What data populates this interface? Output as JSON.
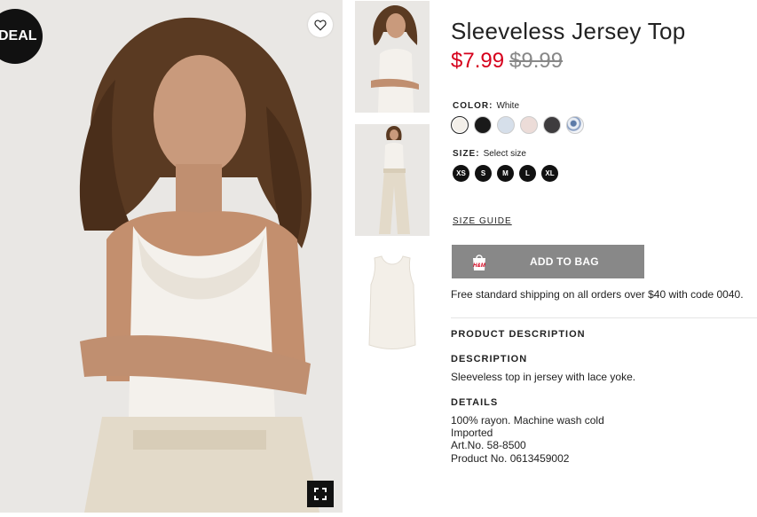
{
  "badge": {
    "deal": "DEAL"
  },
  "product": {
    "title": "Sleeveless Jersey Top",
    "price_sale": "$7.99",
    "price_original": "$9.99"
  },
  "color": {
    "label": "COLOR:",
    "selected": "White",
    "swatches": [
      {
        "name": "White",
        "hex": "#f3efe9"
      },
      {
        "name": "Black",
        "hex": "#1a1a1a"
      },
      {
        "name": "Light blue",
        "hex": "#d6dfea"
      },
      {
        "name": "Light pink",
        "hex": "#ecdcd8"
      },
      {
        "name": "Dark gray",
        "hex": "#3e3c3e"
      },
      {
        "name": "Floral",
        "hex": "#c8d4e4"
      }
    ]
  },
  "size": {
    "label": "SIZE:",
    "placeholder": "Select size",
    "options": [
      "XS",
      "S",
      "M",
      "L",
      "XL"
    ]
  },
  "size_guide": "SIZE GUIDE",
  "add_to_bag": "ADD TO BAG",
  "shipping": "Free standard shipping on all orders over $40 with code 0040.",
  "product_description": {
    "heading": "PRODUCT DESCRIPTION",
    "description_heading": "DESCRIPTION",
    "description": "Sleeveless top in jersey with lace yoke.",
    "details_heading": "DETAILS",
    "details": [
      "100% rayon. Machine wash cold",
      "Imported",
      "Art.No. 58-8500",
      "Product No. 0613459002"
    ]
  },
  "colors": {
    "accent_red": "#d6001c",
    "button_gray": "#888888"
  }
}
